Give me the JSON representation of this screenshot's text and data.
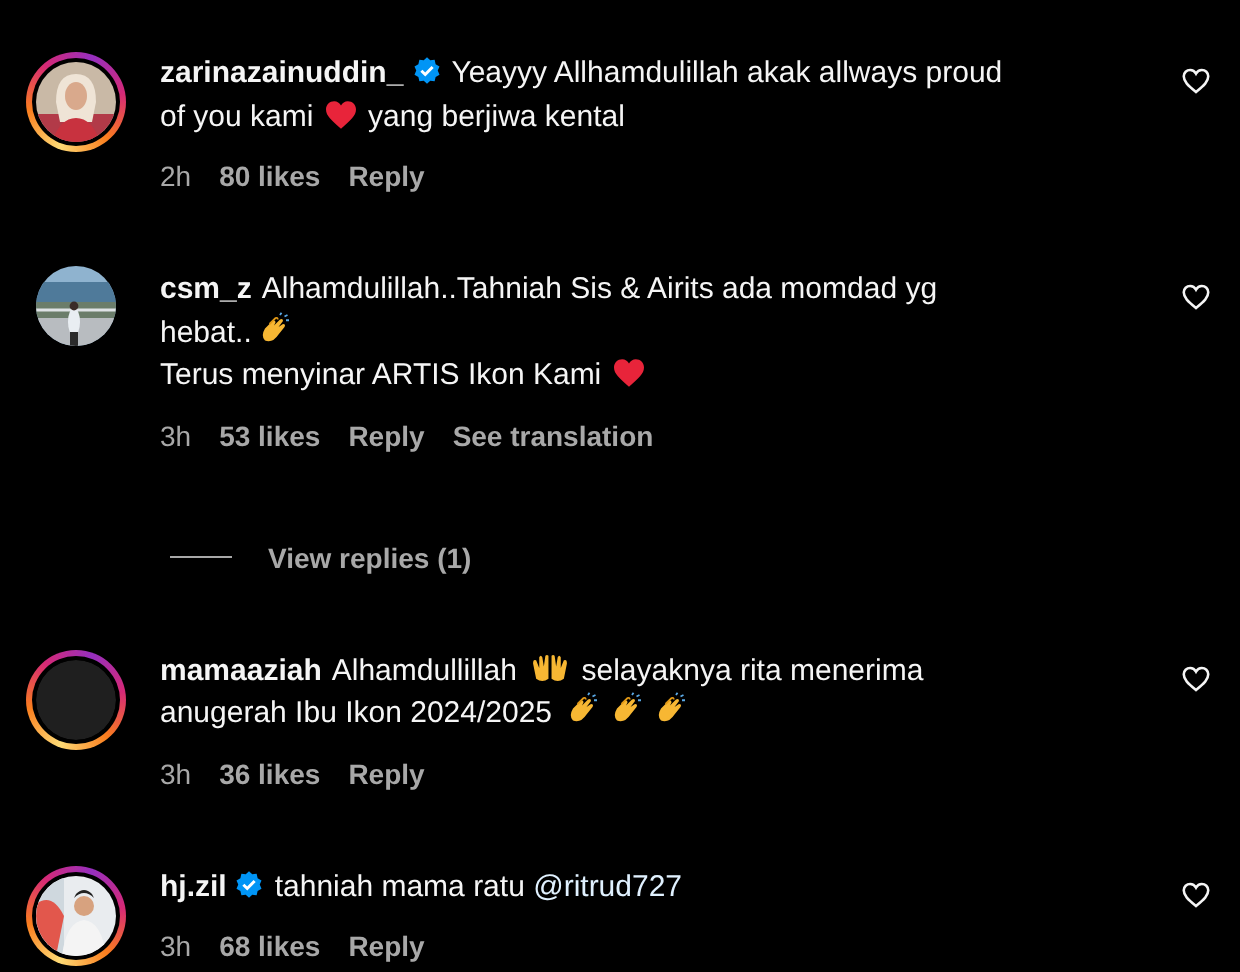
{
  "comments": [
    {
      "username": "zarinazainuddin_",
      "verified": true,
      "avatar": {
        "kind": "picture",
        "story_ring": true
      },
      "liked": false,
      "lines": [
        [
          {
            "kind": "text",
            "text": "Yeayyy Allhamdulillah akak allways proud"
          }
        ],
        [
          {
            "kind": "text",
            "text": "of you kami "
          },
          {
            "kind": "heart"
          },
          {
            "kind": "text",
            "text": " yang berjiwa kental"
          }
        ]
      ],
      "time": "2h",
      "likes": "80 likes",
      "reply": "Reply"
    },
    {
      "username": "csm_z",
      "verified": false,
      "avatar": {
        "kind": "picture",
        "story_ring": false
      },
      "liked": false,
      "lines": [
        [
          {
            "kind": "text",
            "text": "Alhamdulillah..Tahniah Sis & Airits ada momdad yg"
          }
        ],
        [
          {
            "kind": "text",
            "text": "hebat.."
          },
          {
            "kind": "clap"
          }
        ],
        [
          {
            "kind": "text",
            "text": "Terus menyinar ARTIS Ikon Kami "
          },
          {
            "kind": "heart"
          }
        ]
      ],
      "time": "3h",
      "likes": "53 likes",
      "reply": "Reply",
      "translation": "See translation",
      "view_replies": "View replies (1)"
    },
    {
      "username": "mamaaziah",
      "verified": false,
      "avatar": {
        "kind": "blank",
        "story_ring": true
      },
      "liked": false,
      "lines": [
        [
          {
            "kind": "text",
            "text": "Alhamdullillah "
          },
          {
            "kind": "hands"
          },
          {
            "kind": "text",
            "text": " selayaknya rita menerima"
          }
        ],
        [
          {
            "kind": "text",
            "text": "anugerah Ibu Ikon 2024/2025 "
          },
          {
            "kind": "clap"
          },
          {
            "kind": "clap"
          },
          {
            "kind": "clap"
          }
        ]
      ],
      "time": "3h",
      "likes": "36 likes",
      "reply": "Reply"
    },
    {
      "username": "hj.zil",
      "verified": true,
      "avatar": {
        "kind": "picture",
        "story_ring": true
      },
      "liked": false,
      "lines": [
        [
          {
            "kind": "text",
            "text": "tahniah mama ratu "
          },
          {
            "kind": "mention",
            "text": "@ritrud727"
          }
        ]
      ],
      "time": "3h",
      "likes": "68 likes",
      "reply": "Reply"
    }
  ]
}
